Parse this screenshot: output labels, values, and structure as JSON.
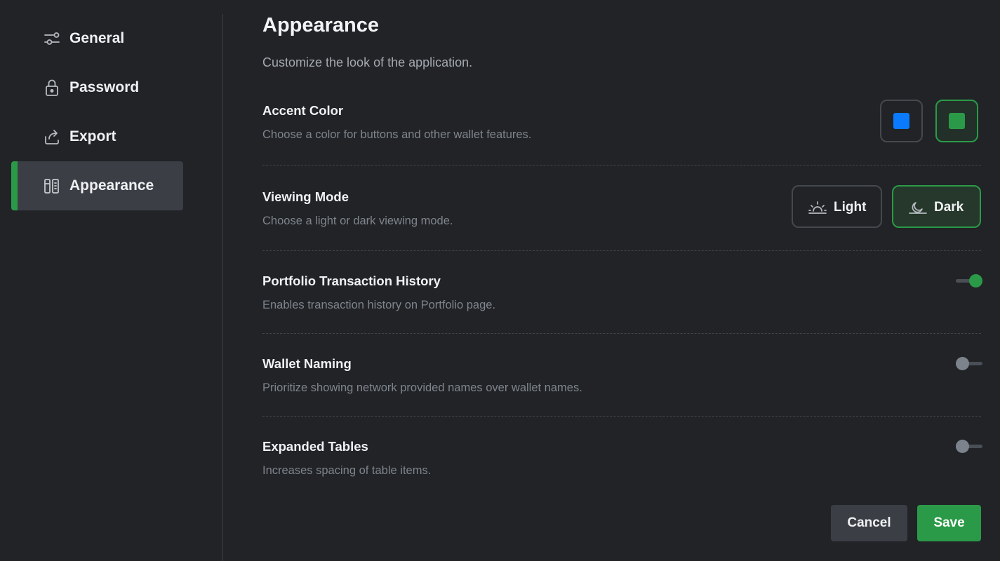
{
  "sidebar": {
    "items": [
      {
        "label": "General",
        "icon": "sliders-icon",
        "active": false
      },
      {
        "label": "Password",
        "icon": "lock-icon",
        "active": false
      },
      {
        "label": "Export",
        "icon": "export-icon",
        "active": false
      },
      {
        "label": "Appearance",
        "icon": "appearance-icon",
        "active": true
      }
    ]
  },
  "header": {
    "title": "Appearance",
    "subtitle": "Customize the look of the application."
  },
  "settings": {
    "accent_color": {
      "title": "Accent Color",
      "description": "Choose a color for buttons and other wallet features.",
      "options": [
        {
          "color": "#0a7aff",
          "selected": false
        },
        {
          "color": "#2b9a48",
          "selected": true
        }
      ]
    },
    "viewing_mode": {
      "title": "Viewing Mode",
      "description": "Choose a light or dark viewing mode.",
      "options": [
        {
          "label": "Light",
          "icon": "sunrise-icon",
          "selected": false
        },
        {
          "label": "Dark",
          "icon": "moon-icon",
          "selected": true
        }
      ]
    },
    "portfolio_history": {
      "title": "Portfolio Transaction History",
      "description": "Enables transaction history on Portfolio page.",
      "enabled": true
    },
    "wallet_naming": {
      "title": "Wallet Naming",
      "description": "Prioritize showing network provided names over wallet names.",
      "enabled": false
    },
    "expanded_tables": {
      "title": "Expanded Tables",
      "description": "Increases spacing of table items.",
      "enabled": false
    }
  },
  "actions": {
    "cancel_label": "Cancel",
    "save_label": "Save"
  },
  "colors": {
    "accent": "#2b9a48",
    "background": "#212327"
  }
}
